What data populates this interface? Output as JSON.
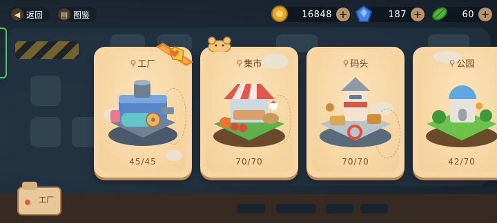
{
  "topbar": {
    "back_label": "返回",
    "atlas_label": "图鉴"
  },
  "resources": {
    "coins": "16848",
    "gems": "187",
    "leaves": "60"
  },
  "cards": [
    {
      "name": "工厂",
      "count": "45/45"
    },
    {
      "name": "集市",
      "count": "70/70"
    },
    {
      "name": "码头",
      "count": "70/70"
    },
    {
      "name": "公园",
      "count": "42/70"
    }
  ],
  "background": {
    "sign_label": "工厂"
  },
  "colors": {
    "card": "#f6d6a4",
    "pin": "#e05a46",
    "title_text": "#6a3f1c",
    "plus_button": "#b8946b"
  }
}
